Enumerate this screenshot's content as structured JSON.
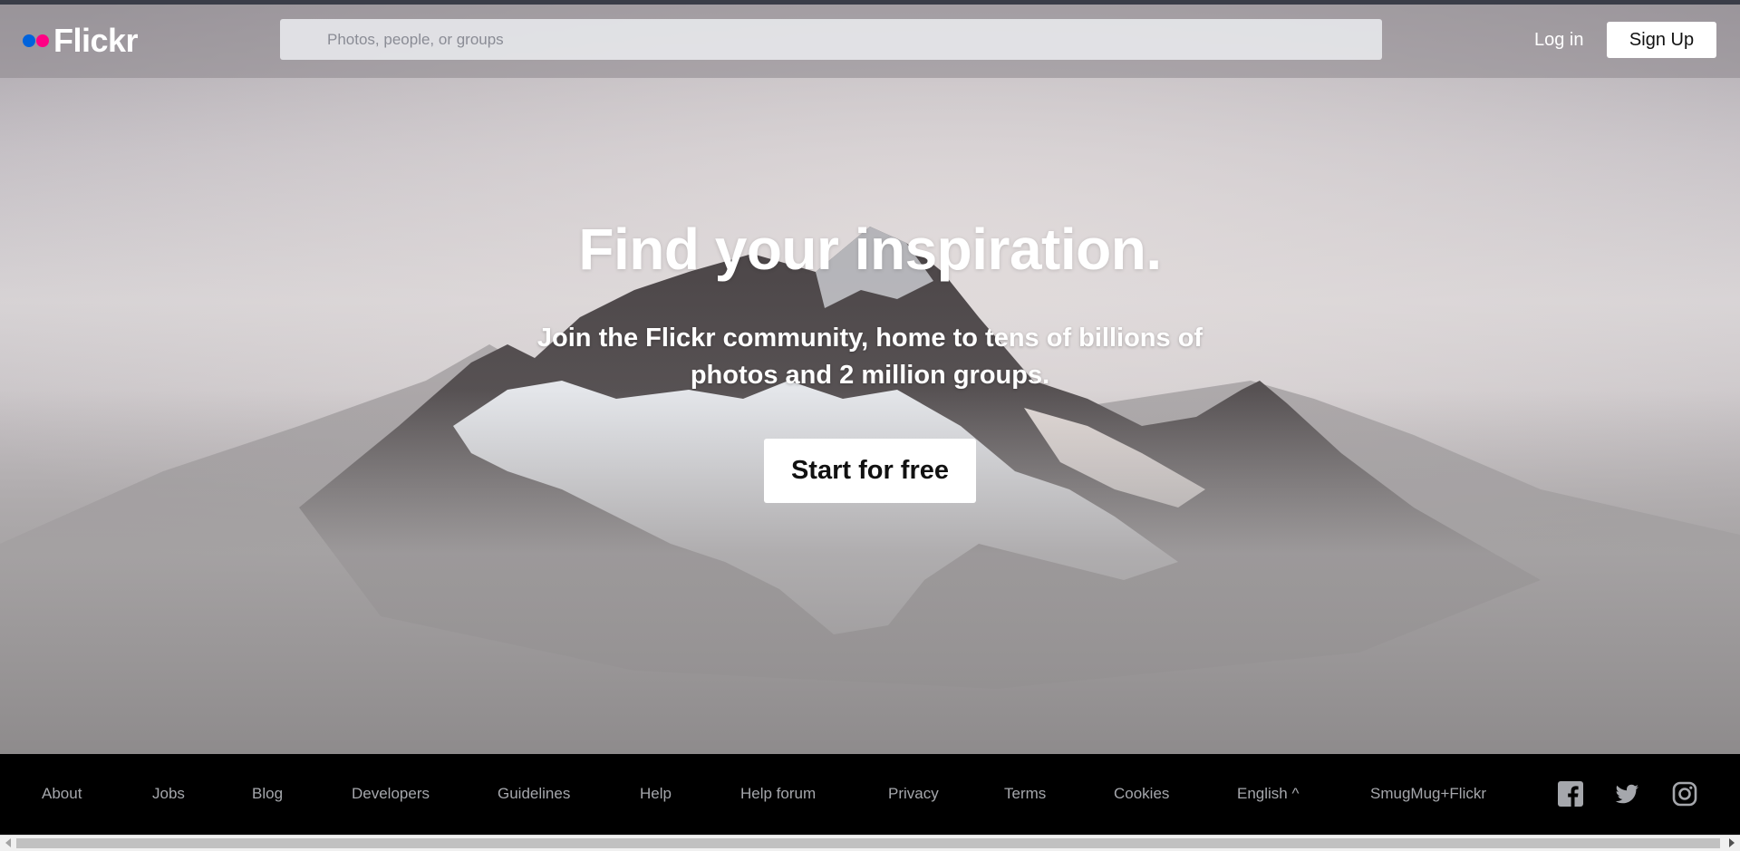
{
  "header": {
    "logo_text": "Flickr",
    "search_placeholder": "Photos, people, or groups",
    "login_label": "Log in",
    "signup_label": "Sign Up"
  },
  "hero": {
    "title": "Find your inspiration.",
    "subtitle": "Join the Flickr community, home to tens of billions of photos and 2 million groups.",
    "cta_label": "Start for free"
  },
  "footer": {
    "links": [
      "About",
      "Jobs",
      "Blog",
      "Developers",
      "Guidelines",
      "Help",
      "Help forum",
      "Privacy",
      "Terms",
      "Cookies",
      "English ^",
      "SmugMug+Flickr"
    ],
    "social_icons": [
      "facebook-icon",
      "twitter-icon",
      "instagram-icon"
    ]
  },
  "colors": {
    "brand_blue": "#0063dc",
    "brand_pink": "#ff0084",
    "footer_bg": "#000000",
    "footer_text": "#a5a7ac"
  }
}
